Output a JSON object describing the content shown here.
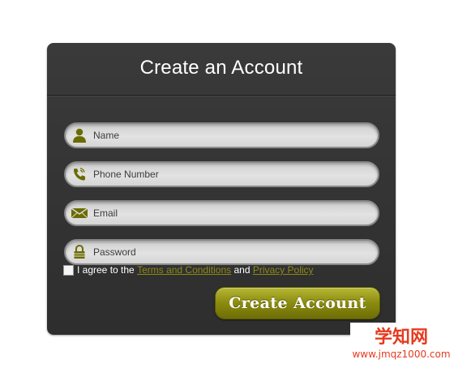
{
  "form": {
    "title": "Create an Account",
    "fields": [
      {
        "icon": "user-icon",
        "placeholder": "Name",
        "value": ""
      },
      {
        "icon": "phone-icon",
        "placeholder": "Phone Number",
        "value": ""
      },
      {
        "icon": "envelope-icon",
        "placeholder": "Email",
        "value": ""
      },
      {
        "icon": "lock-icon",
        "placeholder": "Password",
        "value": ""
      }
    ],
    "agree": {
      "prefix": "I agree to the",
      "terms_link": "Terms and Conditions",
      "and": "and",
      "privacy_link": "Privacy Policy",
      "checked": false
    },
    "submit_label": "Create Account"
  },
  "watermark": {
    "brand": "学知网",
    "url": "www.jmqz1000.com"
  },
  "colors": {
    "panel": "#333333",
    "icon": "#6b6b00",
    "accent": "#8e8e12",
    "link": "#8c8a16",
    "watermark": "#e63a1f"
  }
}
